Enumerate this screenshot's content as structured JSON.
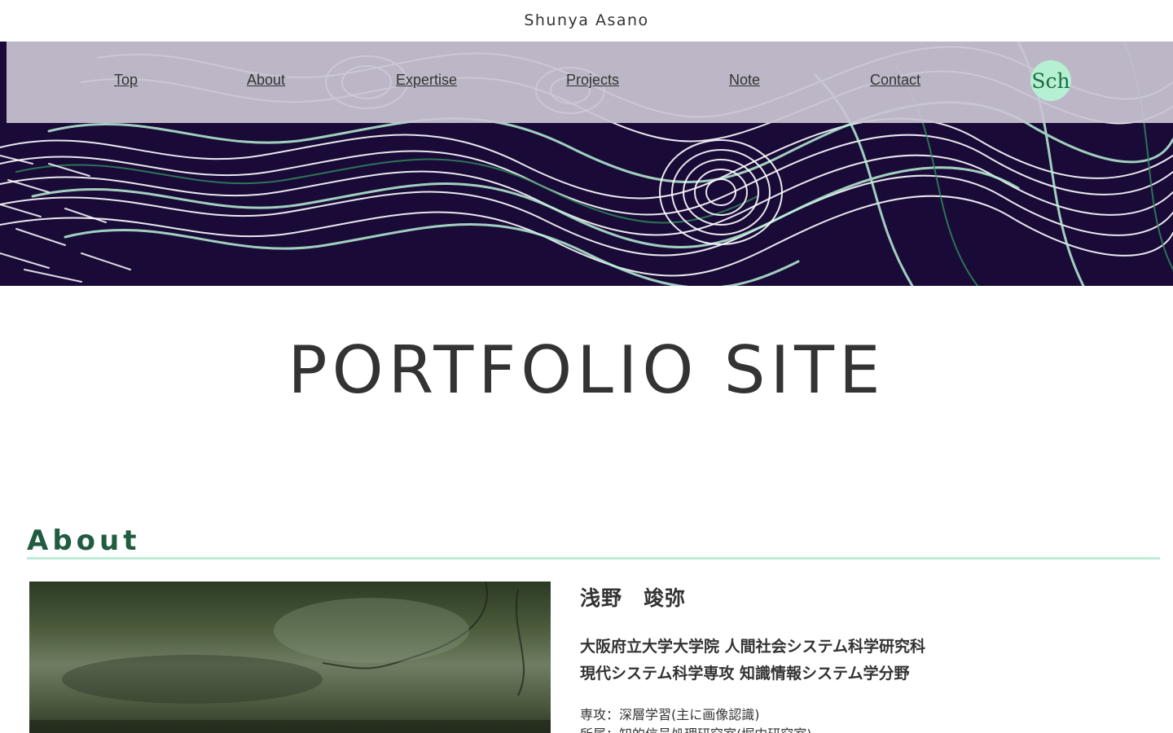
{
  "header": {
    "site_title": "Shunya Asano"
  },
  "nav": {
    "items": [
      {
        "label": "Top"
      },
      {
        "label": "About"
      },
      {
        "label": "Expertise"
      },
      {
        "label": "Projects"
      },
      {
        "label": "Note"
      },
      {
        "label": "Contact"
      }
    ],
    "badge_label": "Sch"
  },
  "hero": {
    "description_colors": {
      "background": "#1a0a38",
      "lines_white": "#ffffff",
      "lines_mint": "#b8f2d6",
      "lines_green": "#2f8f5c"
    }
  },
  "main": {
    "heading": "PORTFOLIO SITE"
  },
  "about": {
    "section_title": "About",
    "name": "浅野　竣弥",
    "affiliation_line1": "大阪府立大学大学院 人間社会システム科学研究科",
    "affiliation_line2": "現代システム科学専攻 知識情報システム学分野",
    "major": "専攻：深層学習(主に画像認識)",
    "lab": "所属：知的信号処理研究室(堀内研究室)"
  },
  "colors": {
    "accent": "#bdebd7",
    "section_title": "#1f5c40",
    "nav_bg": "#c9c4d2",
    "badge_bg": "#b6f0d3"
  }
}
